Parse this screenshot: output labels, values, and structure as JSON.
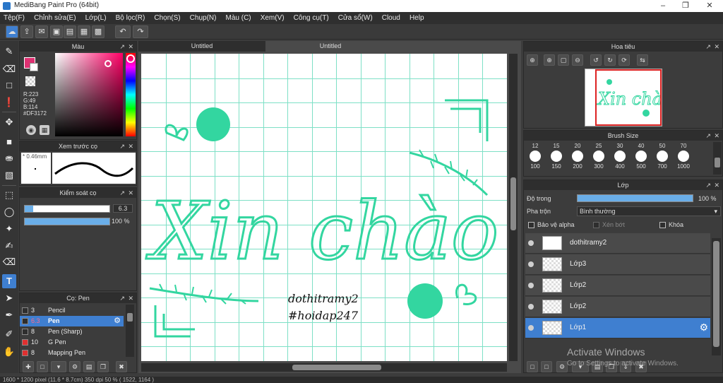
{
  "window": {
    "title": "MediBang Paint Pro (64bit)"
  },
  "menu": [
    "Tệp(F)",
    "Chỉnh sửa(E)",
    "Lớp(L)",
    "Bộ lọc(R)",
    "Chọn(S)",
    "Chụp(N)",
    "Màu (C)",
    "Xem(V)",
    "Công cụ(T)",
    "Cửa sổ(W)",
    "Cloud",
    "Help"
  ],
  "color_panel": {
    "title": "Màu",
    "r": "R:223",
    "g": "G:49",
    "b": "B:114",
    "hex": "#DF3172",
    "primary_color": "#DF3172"
  },
  "brush_preview": {
    "title": "Xem trước cọ",
    "size": "0.46mm"
  },
  "brush_control": {
    "title": "Kiểm soát cọ",
    "size_value": "6.3",
    "opacity_value": "100 %",
    "opacity_fraction": 1.0
  },
  "brush_list": {
    "title": "Cọ: Pen",
    "items": [
      {
        "num": "3",
        "name": "Pencil",
        "color": "#2e2e2e"
      },
      {
        "num": "6.3",
        "name": "Pen",
        "color": "#2e2e2e"
      },
      {
        "num": "8",
        "name": "Pen (Sharp)",
        "color": "#2e2e2e"
      },
      {
        "num": "10",
        "name": "G Pen",
        "color": "#e03030"
      },
      {
        "num": "8",
        "name": "Mapping Pen",
        "color": "#e03030"
      }
    ]
  },
  "canvas": {
    "tabs": [
      "Untitled",
      "Untitled"
    ],
    "text_main": "Xin chào",
    "text_credit_1": "dothitramy2",
    "text_credit_2": "#hoidap247",
    "accent_color": "#33d6a0"
  },
  "navigator": {
    "title": "Hoa tiêu"
  },
  "brush_size": {
    "title": "Brush Size",
    "top": [
      "12",
      "15",
      "20",
      "25",
      "30",
      "40",
      "50",
      "70"
    ],
    "bottom": [
      "100",
      "150",
      "200",
      "300",
      "400",
      "500",
      "700",
      "1000"
    ]
  },
  "layer_panel": {
    "title": "Lớp",
    "opacity_label": "Độ trong",
    "opacity_value": "100 %",
    "blend_label": "Pha trộn",
    "blend_value": "Bình thường",
    "protect_alpha": "Bảo vệ alpha",
    "clipping": "Xén bớt",
    "lock": "Khóa",
    "layers": [
      "dothitramy2",
      "Lớp3",
      "Lớp2",
      "Lớp2",
      "Lớp1"
    ]
  },
  "watermark": {
    "line1": "Activate Windows",
    "line2": "Go to Settings to activate Windows."
  },
  "status": {
    "text": "1600 * 1200 pixel  (11.6 * 8.7cm)  350 dpi  50 %  ( 1522, 1164 )"
  }
}
